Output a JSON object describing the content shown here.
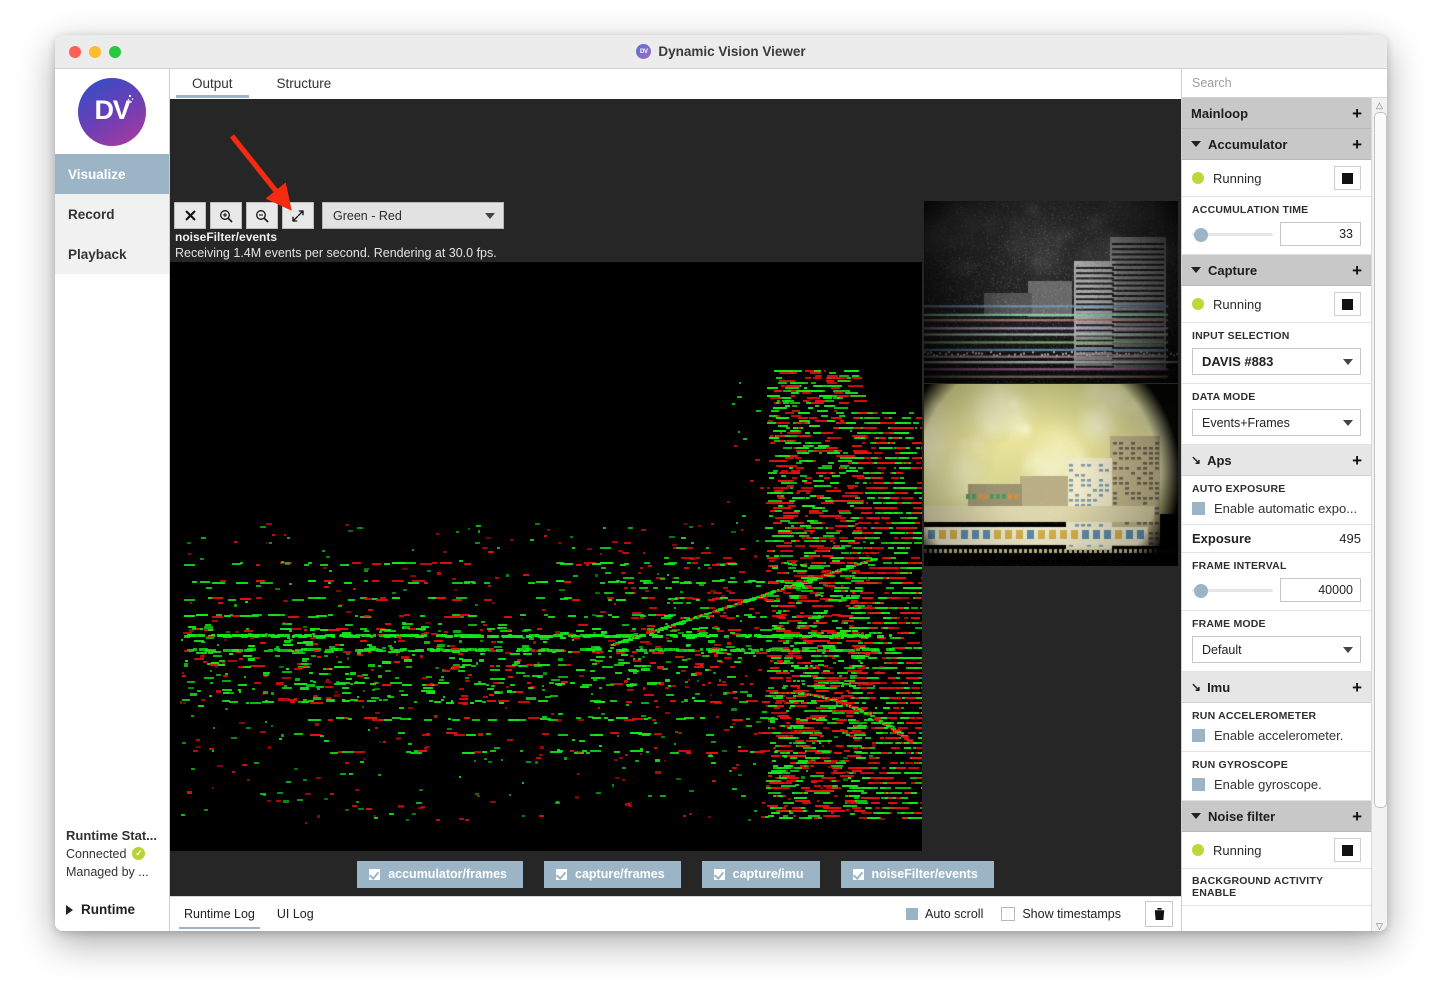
{
  "window": {
    "title": "Dynamic Vision Viewer",
    "logo_mark": "DV"
  },
  "sidebar": {
    "logo_text": "DV",
    "items": [
      {
        "label": "Visualize",
        "active": true
      },
      {
        "label": "Record",
        "active": false
      },
      {
        "label": "Playback",
        "active": false
      }
    ],
    "runtime_status": {
      "title": "Runtime Stat...",
      "connected": "Connected",
      "managed": "Managed by ..."
    },
    "runtime_toggle": "Runtime"
  },
  "tabs": [
    {
      "label": "Output",
      "active": true
    },
    {
      "label": "Structure",
      "active": false
    }
  ],
  "viewport": {
    "toolbar": {
      "close": "✕",
      "zoom_in": "zoom-in-icon",
      "zoom_out": "zoom-out-icon",
      "fit": "fit-icon",
      "colormap_value": "Green - Red"
    },
    "stream_name": "noiseFilter/events",
    "stream_info": "Receiving 1.4M events per second.  Rendering at 30.0 fps."
  },
  "bottom_tabs": [
    {
      "label": "accumulator/frames",
      "checked": true
    },
    {
      "label": "capture/frames",
      "checked": true
    },
    {
      "label": "capture/imu",
      "checked": true
    },
    {
      "label": "noiseFilter/events",
      "checked": true
    }
  ],
  "logbar": {
    "tabs": [
      {
        "label": "Runtime Log",
        "active": true
      },
      {
        "label": "UI Log",
        "active": false
      }
    ],
    "auto_scroll": {
      "label": "Auto scroll",
      "checked": true
    },
    "show_timestamps": {
      "label": "Show timestamps",
      "checked": false
    },
    "clear_icon": "trash-icon"
  },
  "right_panel": {
    "search_placeholder": "Search",
    "groups": [
      {
        "name": "mainloop",
        "title": "Mainloop",
        "collapsed": true,
        "indicator": "none",
        "add_label": "+",
        "rows": []
      },
      {
        "name": "accumulator",
        "title": "Accumulator",
        "collapsed": false,
        "indicator": "triangle",
        "add_label": "+",
        "rows": [
          {
            "type": "status",
            "text": "Running",
            "color": "#bdd73b",
            "button": "stop-button"
          },
          {
            "type": "slider",
            "caption": "ACCUMULATION TIME",
            "value": "33",
            "pct": 2
          }
        ]
      },
      {
        "name": "capture",
        "title": "Capture",
        "collapsed": false,
        "indicator": "triangle",
        "add_label": "+",
        "rows": [
          {
            "type": "status",
            "text": "Running",
            "color": "#bdd73b",
            "button": "stop-button"
          },
          {
            "type": "select",
            "caption": "INPUT SELECTION",
            "value": "DAVIS #883",
            "bold": true
          },
          {
            "type": "select",
            "caption": "DATA MODE",
            "value": "Events+Frames",
            "bold": false
          }
        ]
      },
      {
        "name": "aps",
        "title": "Aps",
        "collapsed": true,
        "indicator": "arrow-se",
        "add_label": "+",
        "rows": [
          {
            "type": "checkbox",
            "caption": "AUTO EXPOSURE",
            "label": "Enable automatic expo...",
            "checked": true
          },
          {
            "type": "kv",
            "key": "Exposure",
            "value": "495"
          },
          {
            "type": "slider",
            "caption": "FRAME INTERVAL",
            "value": "40000",
            "pct": 2
          },
          {
            "type": "select",
            "caption": "FRAME MODE",
            "value": "Default",
            "bold": false
          }
        ]
      },
      {
        "name": "imu",
        "title": "Imu",
        "collapsed": true,
        "indicator": "arrow-se",
        "add_label": "+",
        "rows": [
          {
            "type": "checkbox",
            "caption": "RUN ACCELEROMETER",
            "label": "Enable accelerometer.",
            "checked": true
          },
          {
            "type": "checkbox",
            "caption": "RUN GYROSCOPE",
            "label": "Enable gyroscope.",
            "checked": true
          }
        ]
      },
      {
        "name": "noise-filter",
        "title": "Noise filter",
        "collapsed": false,
        "indicator": "triangle",
        "add_label": "+",
        "rows": [
          {
            "type": "status",
            "text": "Running",
            "color": "#bdd73b",
            "button": "stop-button"
          },
          {
            "type": "caption-only",
            "caption": "BACKGROUND ACTIVITY ENABLE"
          }
        ]
      }
    ]
  },
  "colors": {
    "accent": "#9bb5c6",
    "status_green": "#bdd73b",
    "group_header": "#c8c8c8",
    "subgroup_header": "#e6e6e6",
    "annotation_arrow": "#f42b10",
    "event_positive": "#15e81a",
    "event_negative": "#e81010"
  }
}
